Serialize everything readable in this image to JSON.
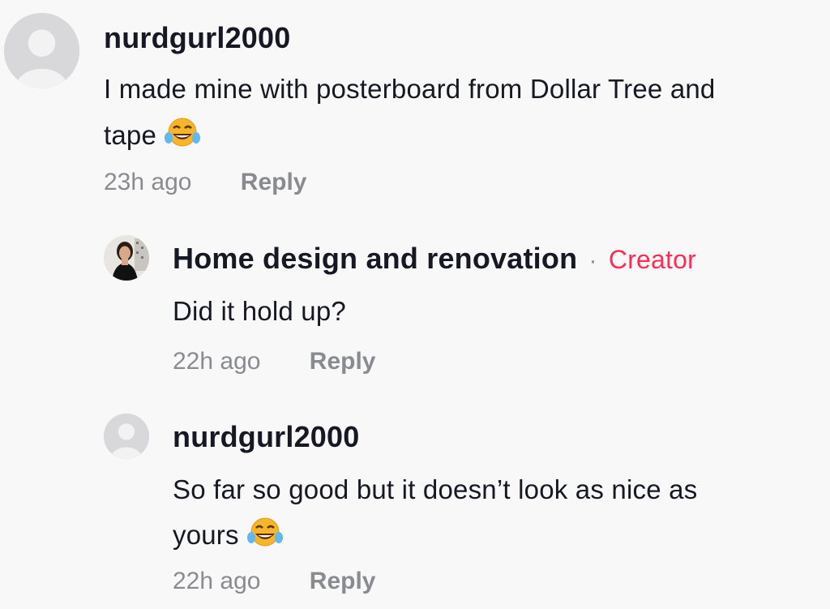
{
  "comments": [
    {
      "username": "nurdgurl2000",
      "text_line1": "I made mine with posterboard from Dollar Tree and",
      "text_line2": "tape",
      "time": "23h ago",
      "reply_label": "Reply",
      "avatar_icon": "default-avatar-icon",
      "emoji_icon": "tears-of-joy-emoji-icon"
    },
    {
      "username": "Home design and renovation",
      "separator": "·",
      "badge": "Creator",
      "text": "Did it hold up?",
      "time": "22h ago",
      "reply_label": "Reply",
      "avatar_icon": "profile-photo-avatar"
    },
    {
      "username": "nurdgurl2000",
      "text_line1": "So far so good but it doesn’t look as nice as",
      "text_line2": "yours",
      "time": "22h ago",
      "reply_label": "Reply",
      "avatar_icon": "default-avatar-icon",
      "emoji_icon": "tears-of-joy-emoji-icon"
    }
  ],
  "colors": {
    "background": "#f8f8f8",
    "text": "#161823",
    "muted": "#8a8b91",
    "creator": "#fe2c55"
  }
}
